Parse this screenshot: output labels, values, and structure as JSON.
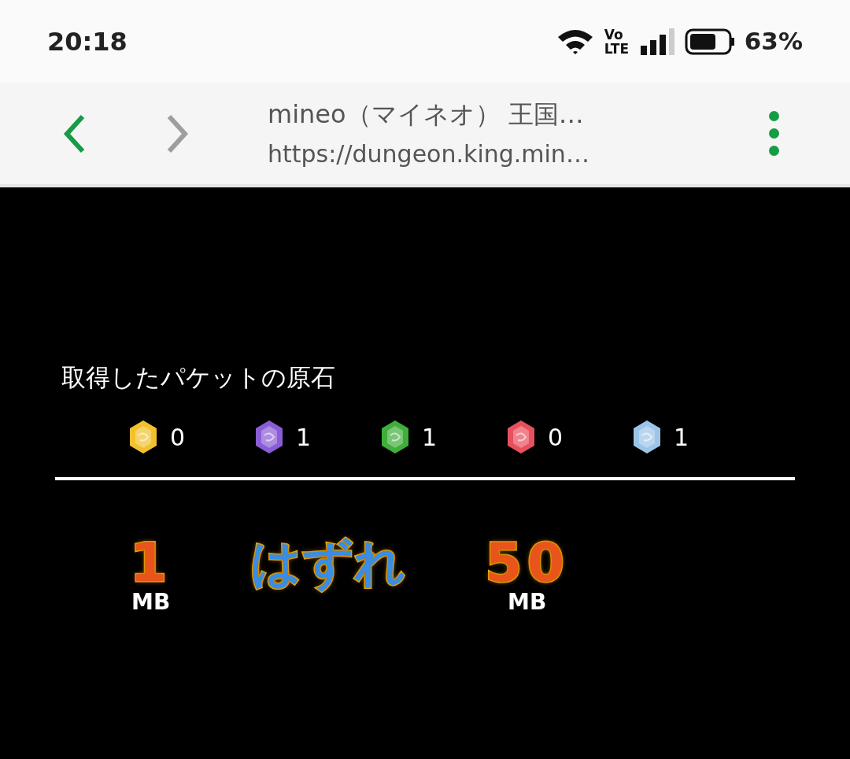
{
  "status_bar": {
    "time": "20:18",
    "network": "Vo LTE",
    "battery": "63%"
  },
  "browser": {
    "title": "mineo（マイネオ） 王国…",
    "url": "https://dungeon.king.min…",
    "back_disabled": false,
    "forward_disabled": true
  },
  "gems": {
    "title": "取得したパケットの原石",
    "items": [
      {
        "color": "#f2c12e",
        "count": "0"
      },
      {
        "color": "#8a5cd6",
        "count": "1"
      },
      {
        "color": "#3fae3a",
        "count": "1"
      },
      {
        "color": "#e8505e",
        "count": "0"
      },
      {
        "color": "#9cc4e8",
        "count": "1"
      }
    ]
  },
  "results": [
    {
      "kind": "prize",
      "value": "1",
      "unit": "MB"
    },
    {
      "kind": "miss",
      "value": "はずれ"
    },
    {
      "kind": "prize",
      "value": "50",
      "unit": "MB"
    }
  ]
}
